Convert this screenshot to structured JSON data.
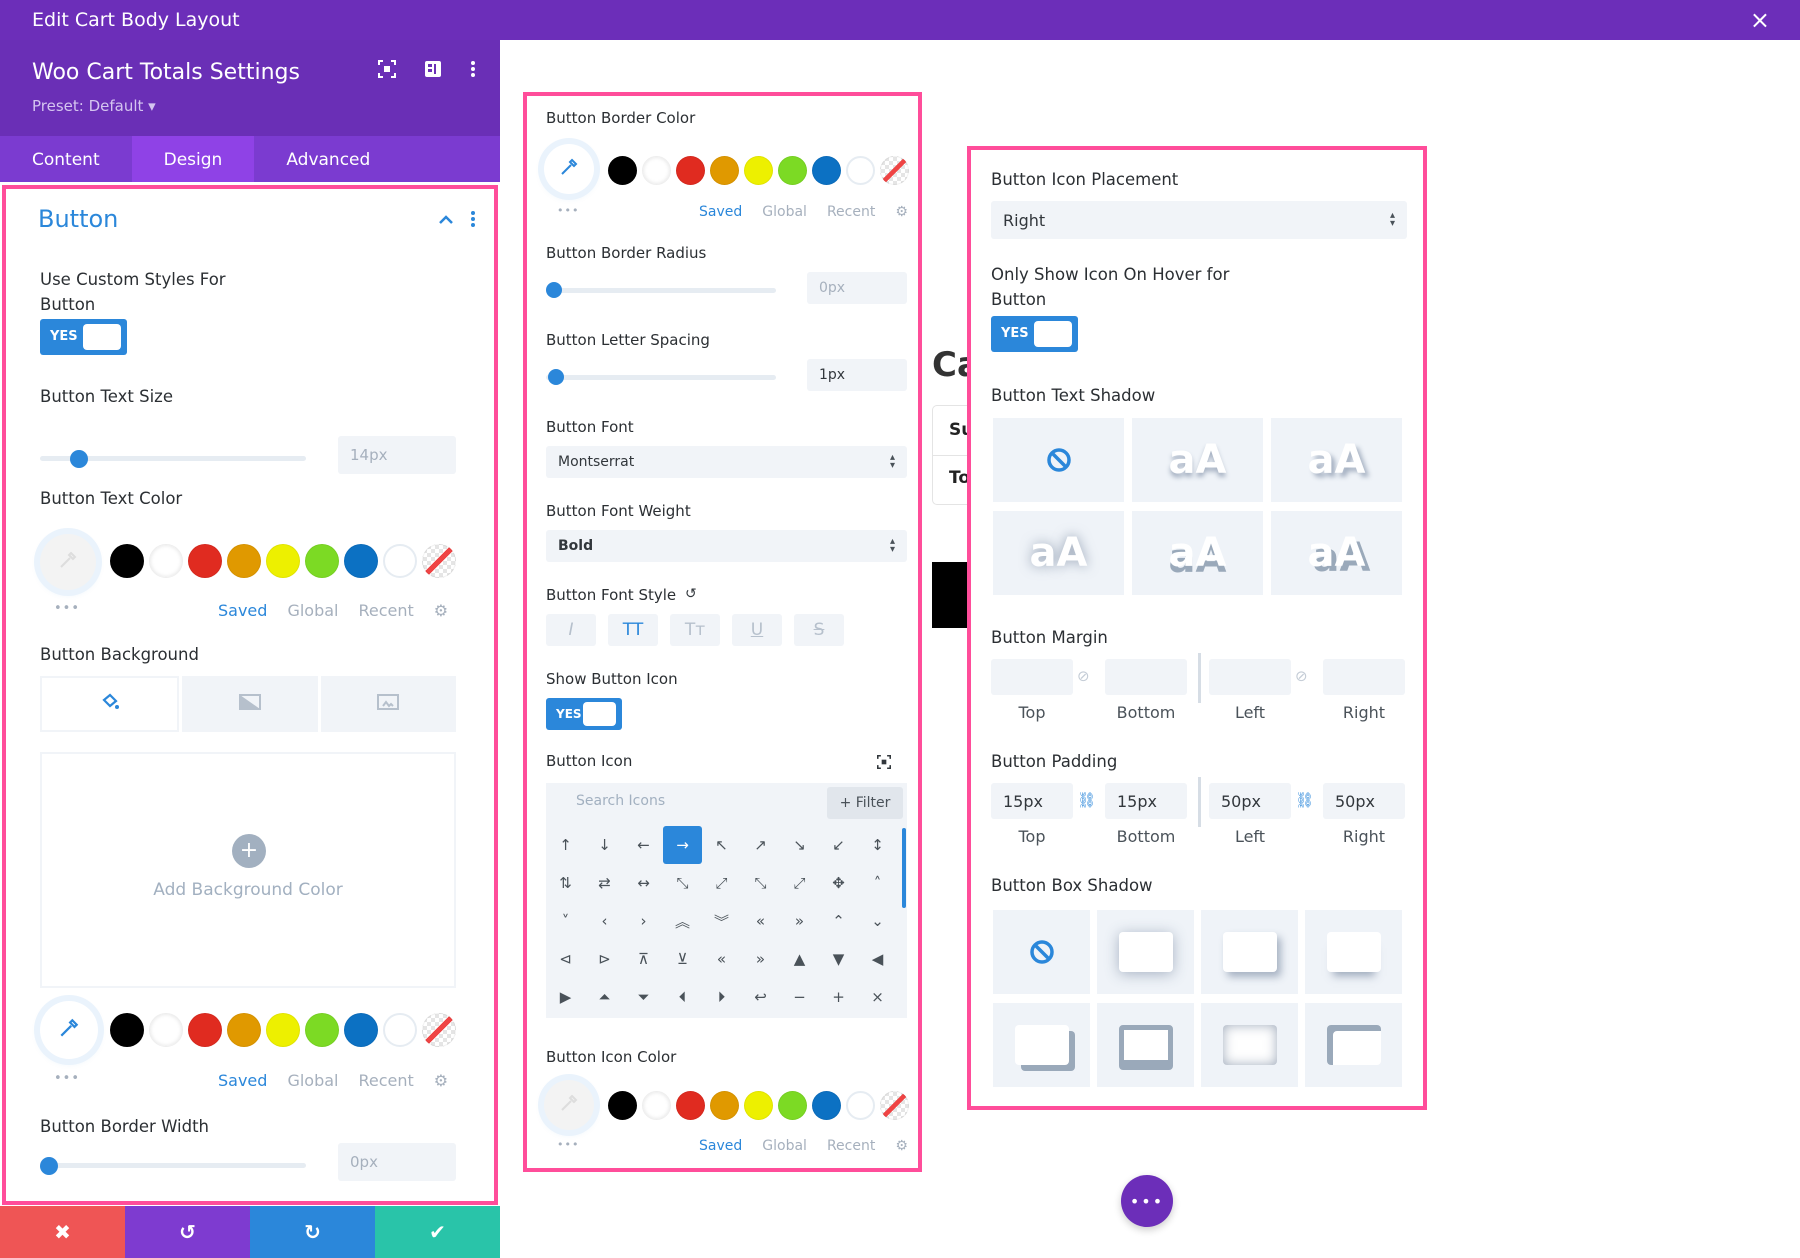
{
  "window": {
    "title": "Edit Cart Body Layout",
    "close_icon": "×"
  },
  "sidebar": {
    "title": "Woo Cart Totals Settings",
    "preset": "Preset: Default ▾",
    "header_icons": [
      "focus-icon",
      "split-view-icon",
      "more-vertical-icon"
    ],
    "tabs": [
      {
        "label": "Content",
        "active": false
      },
      {
        "label": "Design",
        "active": true
      },
      {
        "label": "Advanced",
        "active": false
      }
    ],
    "section": {
      "title": "Button",
      "use_custom_styles": {
        "label": "Use Custom Styles For Button",
        "value": "YES"
      },
      "text_size": {
        "label": "Button Text Size",
        "value": "14px",
        "slider_fraction": 0.12
      },
      "text_color": {
        "label": "Button Text Color"
      },
      "background": {
        "label": "Button Background",
        "add_label": "Add Background Color"
      },
      "border_width": {
        "label": "Button Border Width",
        "value": "0px",
        "slider_fraction": 0.0
      }
    },
    "footer": {
      "cancel": "✖",
      "undo": "↺",
      "redo": "↻",
      "save": "✔"
    },
    "footer_colors": {
      "cancel": "#ef5555",
      "undo": "#7e3bd0",
      "redo": "#2b87da",
      "save": "#29c4a9"
    }
  },
  "palette": {
    "colors": [
      "#000000",
      "#ffffff",
      "#e02b20",
      "#e09900",
      "#edf000",
      "#7cda24",
      "#0c71c3",
      "#ffffff",
      "transparent"
    ],
    "tabs": [
      "Saved",
      "Global",
      "Recent"
    ],
    "active_tab": "Saved",
    "dots": "•••"
  },
  "middle": {
    "border_color": {
      "label": "Button Border Color"
    },
    "border_radius": {
      "label": "Button Border Radius",
      "value": "0px",
      "slider_fraction": 0.0
    },
    "letter_spacing": {
      "label": "Button Letter Spacing",
      "value": "1px",
      "slider_fraction": 0.02
    },
    "font": {
      "label": "Button Font",
      "value": "Montserrat"
    },
    "font_weight": {
      "label": "Button Font Weight",
      "value": "Bold"
    },
    "font_style": {
      "label": "Button Font Style",
      "buttons": [
        "I",
        "TT",
        "Tт",
        "U",
        "S"
      ],
      "active": "TT"
    },
    "show_icon": {
      "label": "Show Button Icon",
      "value": "YES"
    },
    "icon": {
      "label": "Button Icon",
      "search_placeholder": "Search Icons",
      "filter_label": "+ Filter",
      "selected": "→",
      "glyphs": [
        [
          "↑",
          "↓",
          "←",
          "→",
          "↖",
          "↗",
          "↘",
          "↙",
          "↕"
        ],
        [
          "⇅",
          "⇄",
          "↔",
          "⤡",
          "⤢",
          "⤡",
          "⤢",
          "✥",
          "˄"
        ],
        [
          "˅",
          "‹",
          "›",
          "︽",
          "︾",
          "«",
          "»",
          "⌃",
          "⌄"
        ],
        [
          "⊲",
          "⊳",
          "⊼",
          "⊻",
          "«",
          "»",
          "▲",
          "▼",
          "◀"
        ],
        [
          "▶",
          "⏶",
          "⏷",
          "⏴",
          "⏵",
          "↩",
          "−",
          "+",
          "×"
        ]
      ]
    },
    "icon_color": {
      "label": "Button Icon Color"
    }
  },
  "right": {
    "icon_placement": {
      "label": "Button Icon Placement",
      "value": "Right"
    },
    "hover_icon": {
      "label": "Only Show Icon On Hover for Button",
      "value": "YES"
    },
    "text_shadow": {
      "label": "Button Text Shadow",
      "sample": "aA",
      "options": 6,
      "selected": 0
    },
    "margin": {
      "label": "Button Margin",
      "fields": [
        {
          "label": "Top",
          "value": ""
        },
        {
          "label": "Bottom",
          "value": ""
        },
        {
          "label": "Left",
          "value": ""
        },
        {
          "label": "Right",
          "value": ""
        }
      ]
    },
    "padding": {
      "label": "Button Padding",
      "fields": [
        {
          "label": "Top",
          "value": "15px"
        },
        {
          "label": "Bottom",
          "value": "15px"
        },
        {
          "label": "Left",
          "value": "50px"
        },
        {
          "label": "Right",
          "value": "50px"
        }
      ]
    },
    "box_shadow": {
      "label": "Button Box Shadow",
      "options": 8,
      "selected": 0
    }
  },
  "canvas": {
    "title_partial": "Ca",
    "rows": [
      "Su",
      "To"
    ],
    "fab": "•••"
  },
  "colors": {
    "accent": "#2b87da",
    "brand_purple": "#6c2eb9",
    "highlight_pink": "#ff4d9a"
  }
}
